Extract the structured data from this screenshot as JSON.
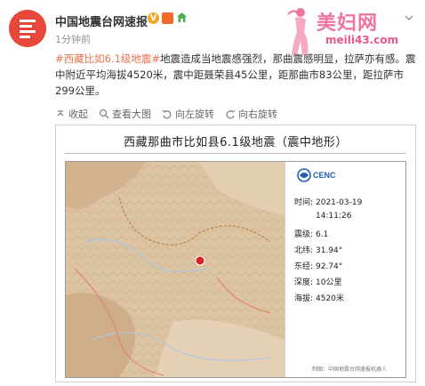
{
  "account": {
    "name": "中国地震台网速报",
    "verified_badge": "V",
    "post_time": "1分钟前"
  },
  "watermark": {
    "title": "美妇网",
    "url": "meili43.com"
  },
  "post": {
    "hashtag": "#西藏比如6.1级地震#",
    "body": "地震造成当地震感强烈，那曲震感明显，拉萨亦有感。震中附近平均海拔4520米，震中距聂荣县45公里，距那曲市83公里，距拉萨市299公里。"
  },
  "toolbar": {
    "collapse_label": "收起",
    "view_image_label": "查看大图",
    "rotate_left_label": "向左旋转",
    "rotate_right_label": "向右旋转"
  },
  "map_card": {
    "title": "西藏那曲市比如县6.1级地震（震中地形）",
    "logo_text": "CENC",
    "info": [
      {
        "label": "时间:",
        "value": "2021-03-19"
      },
      {
        "label": "",
        "value": "14:11:26"
      },
      {
        "label": "震级:",
        "value": "6.1"
      },
      {
        "label": "北纬:",
        "value": "31.94°"
      },
      {
        "label": "东经:",
        "value": "92.74°"
      },
      {
        "label": "深度:",
        "value": "10公里"
      },
      {
        "label": "海拔:",
        "value": "4520米"
      }
    ],
    "footer": "制图：中国地震台网速报机器人"
  },
  "colors": {
    "accent": "#eb7350",
    "avatar_red": "#e8473c",
    "watermark_pink": "#f0749b",
    "epicenter": "#d9231f"
  }
}
